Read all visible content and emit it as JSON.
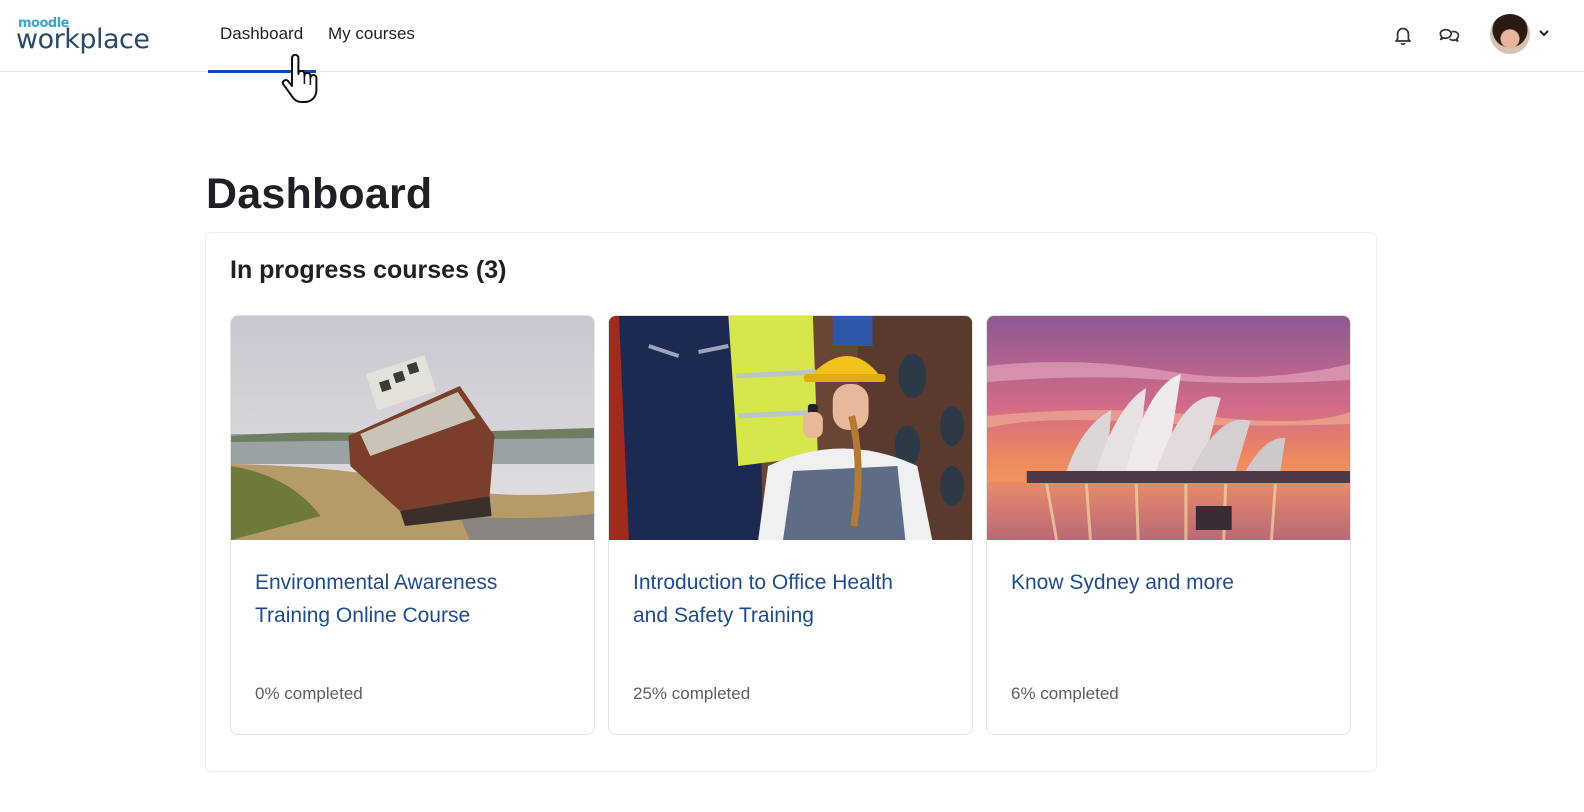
{
  "logo": {
    "top_text": "moodle",
    "main_text": "workplace"
  },
  "nav": {
    "items": [
      {
        "label": "Dashboard",
        "active": true
      },
      {
        "label": "My courses",
        "active": false
      }
    ],
    "icons": [
      "bell-icon",
      "chat-icon",
      "avatar",
      "chevron-down-icon"
    ]
  },
  "main": {
    "page_title": "Dashboard",
    "block_title": "In progress courses (3)",
    "courses": [
      {
        "title": "Environmental Awareness Training Online Course",
        "progress_text": "0% completed",
        "progress": 0,
        "image": "shipwreck-on-beach"
      },
      {
        "title": "Introduction to Office Health and Safety Training",
        "progress_text": "25% completed",
        "progress": 25,
        "image": "worker-with-hard-hat"
      },
      {
        "title": "Know Sydney and more",
        "progress_text": "6% completed",
        "progress": 6,
        "image": "sydney-opera-house-sunset"
      }
    ]
  },
  "colors": {
    "active_tab": "#0f47ad",
    "link": "#1f4c8f",
    "logo_blue": "#3aa7c9",
    "logo_dark": "#2a4a6b"
  }
}
